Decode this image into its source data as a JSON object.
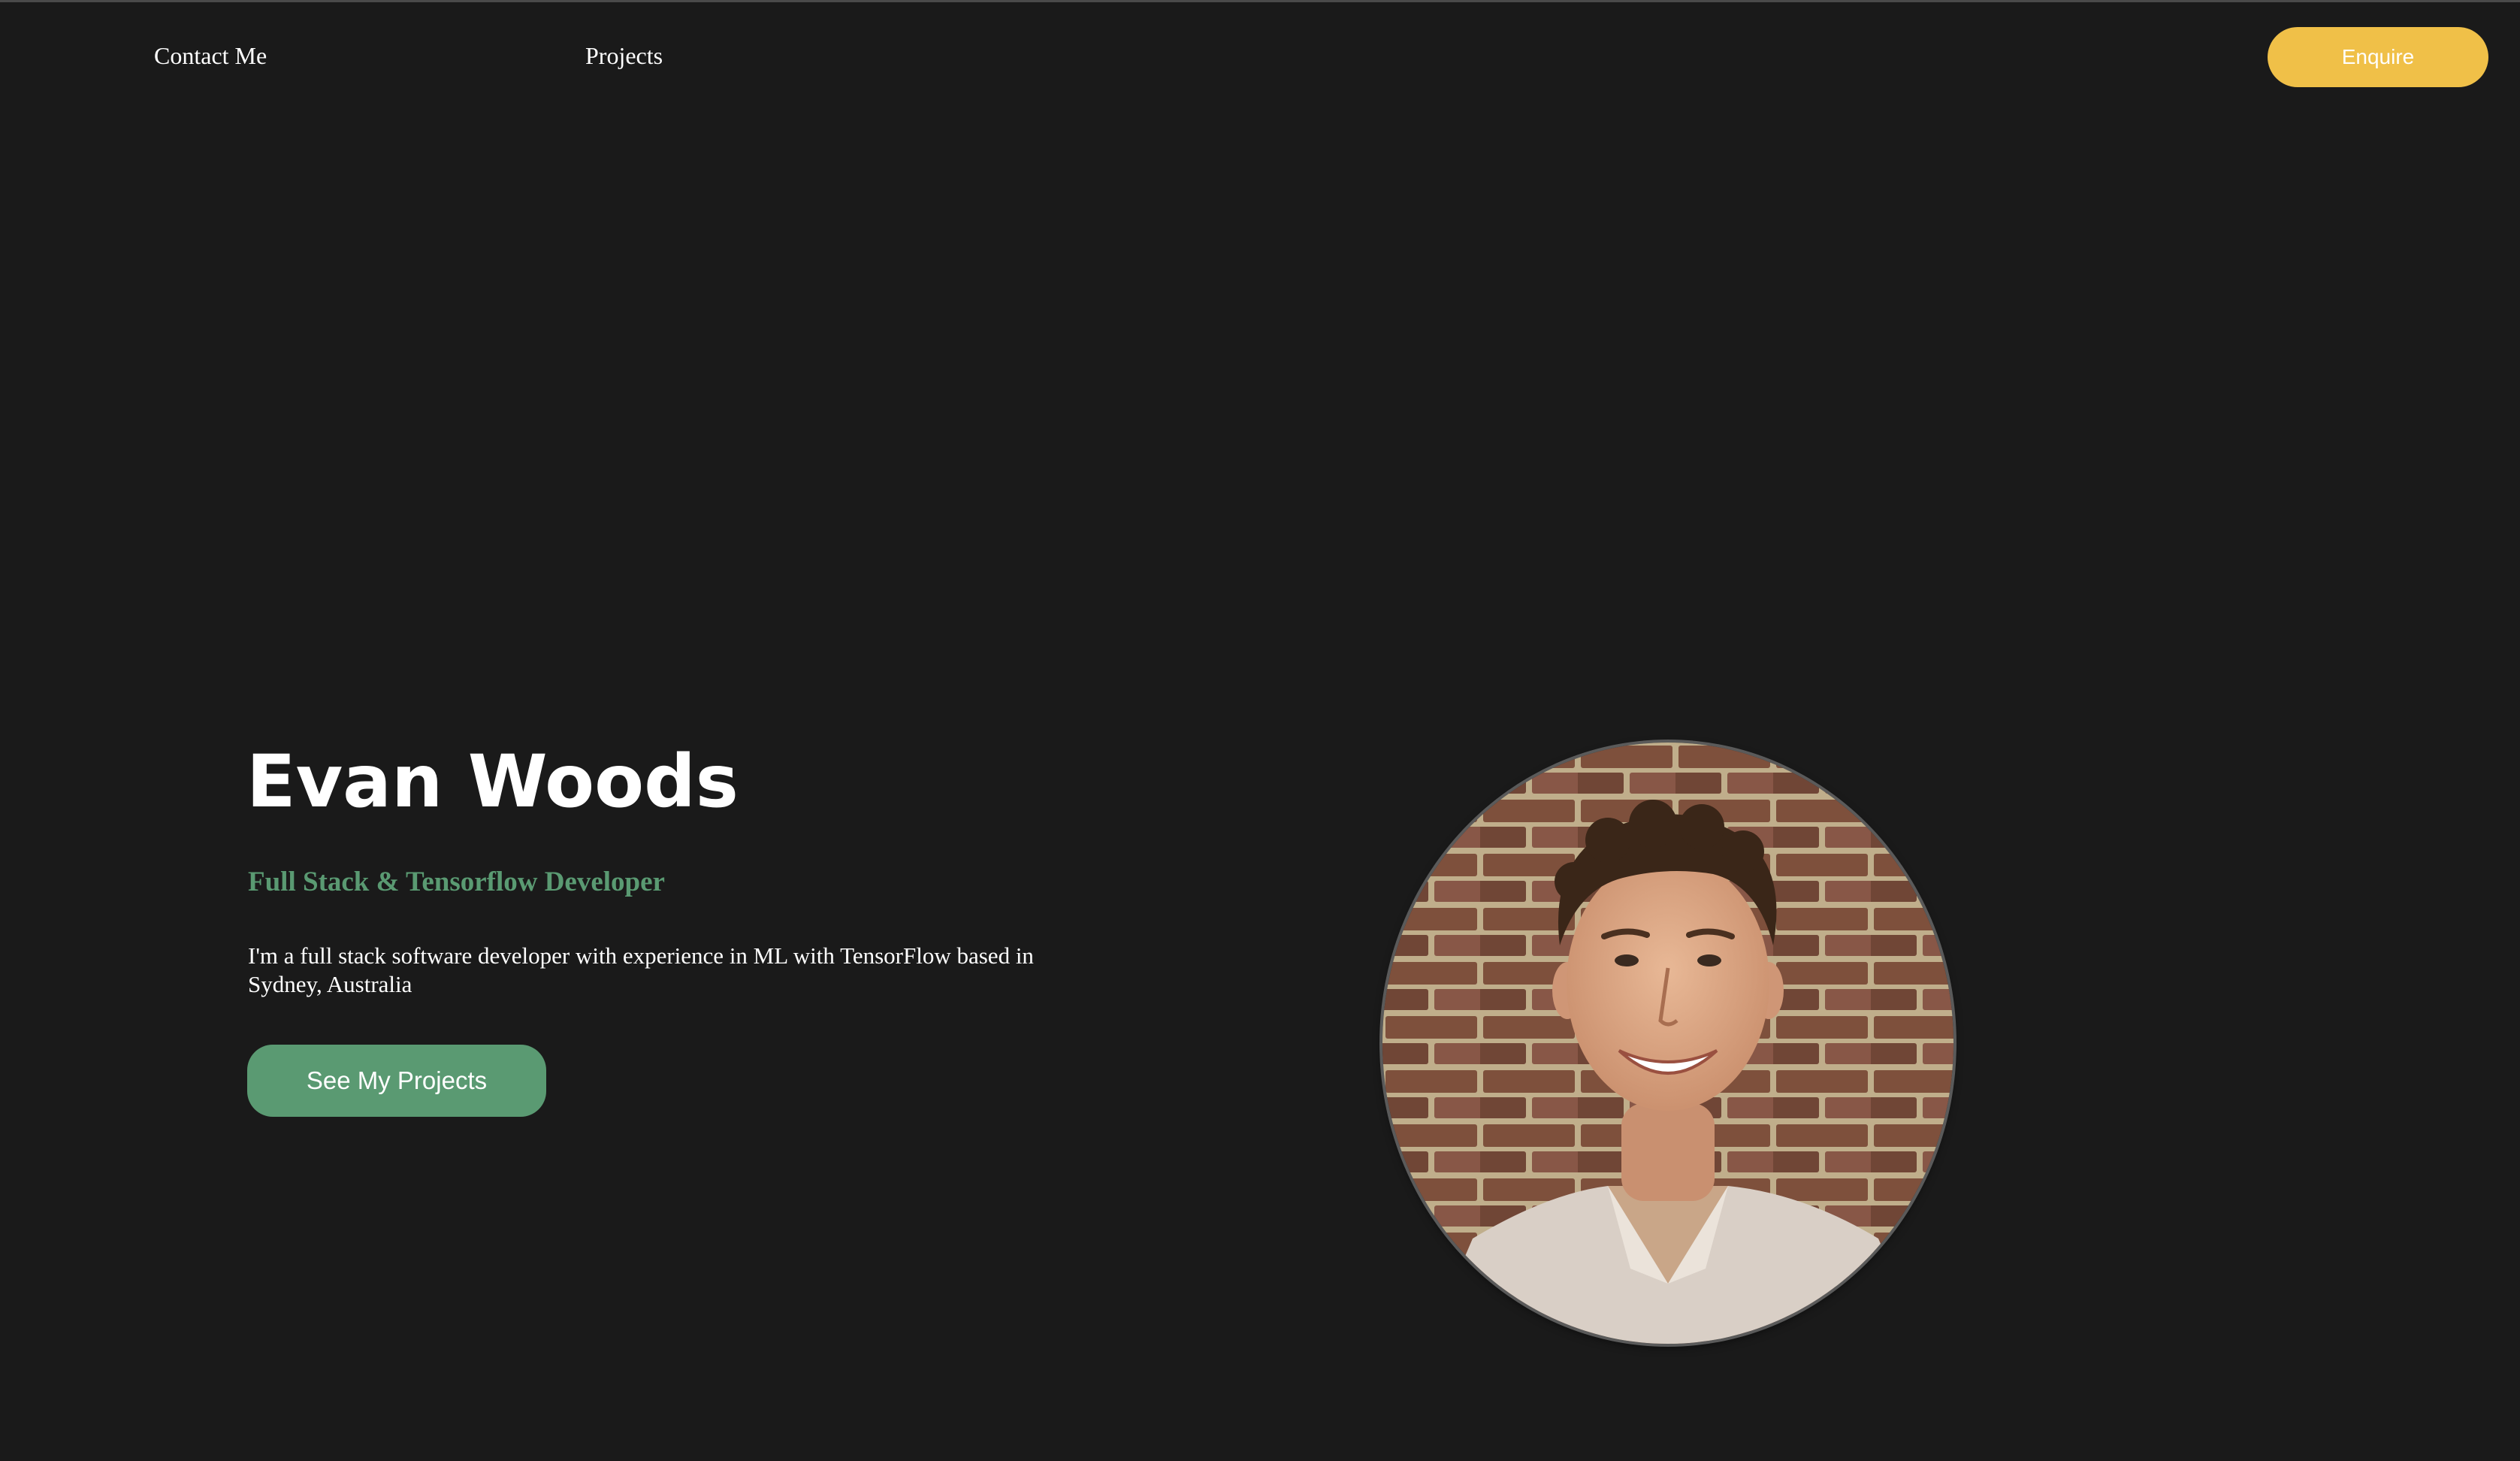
{
  "nav": {
    "contact_label": "Contact Me",
    "projects_label": "Projects",
    "enquire_label": "Enquire"
  },
  "hero": {
    "name": "Evan Woods",
    "role": "Full Stack & Tensorflow Developer",
    "description": "I'm a full stack software developer with experience in ML with TensorFlow based in Sydney, Australia",
    "cta_label": "See My Projects"
  },
  "colors": {
    "background": "#1a1a1a",
    "accent_green": "#5a9a72",
    "accent_yellow": "#f0c048",
    "text": "#ffffff"
  }
}
